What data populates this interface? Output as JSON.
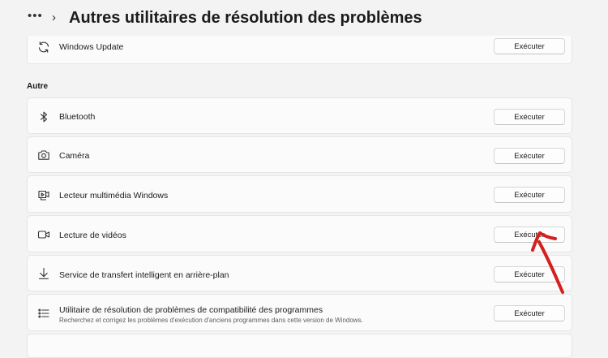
{
  "header": {
    "title": "Autres utilitaires de résolution des problèmes",
    "more": "•••",
    "separator": "›"
  },
  "run_label": "Exécuter",
  "section": {
    "title": "Autre"
  },
  "items": [
    {
      "label": "Windows Update",
      "icon": "refresh-icon"
    },
    {
      "label": "Bluetooth",
      "icon": "bluetooth-icon"
    },
    {
      "label": "Caméra",
      "icon": "camera-icon"
    },
    {
      "label": "Lecteur multimédia Windows",
      "icon": "media-player-icon"
    },
    {
      "label": "Lecture de vidéos",
      "icon": "video-camera-icon"
    },
    {
      "label": "Service de transfert intelligent en arrière-plan",
      "icon": "download-arrow-icon"
    },
    {
      "label": "Utilitaire de résolution de problèmes de compatibilité des programmes",
      "description": "Recherchez et corrigez les problèmes d'exécution d'anciens programmes dans cette version de Windows.",
      "icon": "list-icon"
    }
  ],
  "colors": {
    "annotation_arrow": "#d61f1f",
    "background": "#f3f3f3",
    "card": "#fbfbfb"
  }
}
